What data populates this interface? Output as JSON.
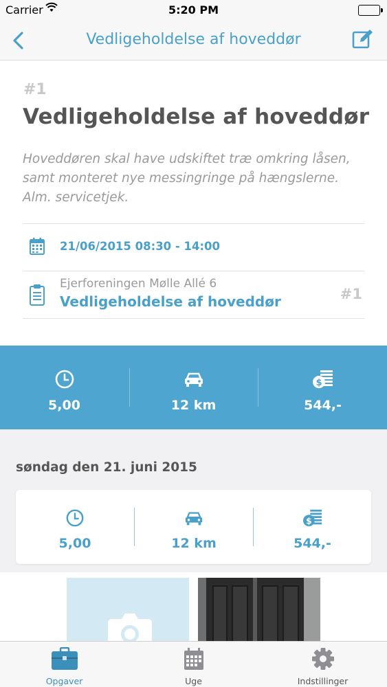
{
  "status_bar": {
    "carrier": "Carrier",
    "time": "5:20 PM"
  },
  "nav": {
    "title": "Vedligeholdelse af hoveddør",
    "back_icon": "chevron-left-icon",
    "edit_icon": "edit-icon"
  },
  "task": {
    "number": "#1",
    "title": "Vedligeholdelse af hoveddør",
    "description": "Hoveddøren skal have udskiftet træ omkring låsen, samt monteret nye messingringe på hængslerne. Alm. servicetjek.",
    "date_range": "21/06/2015 08:30 - 14:00",
    "project_owner": "Ejerforeningen Mølle Allé 6",
    "project_name": "Vedligeholdelse af hoveddør",
    "project_number": "#1"
  },
  "totals": {
    "hours": "5,00",
    "distance": "12 km",
    "amount": "544,-"
  },
  "day": {
    "label": "søndag den 21. juni 2015",
    "hours": "5,00",
    "distance": "12 km",
    "amount": "544,-"
  },
  "tabs": [
    {
      "label": "Opgaver",
      "icon": "briefcase-icon",
      "active": true
    },
    {
      "label": "Uge",
      "icon": "calendar-icon",
      "active": false
    },
    {
      "label": "Indstillinger",
      "icon": "gear-icon",
      "active": false
    }
  ],
  "colors": {
    "accent": "#4aa0c8",
    "band": "#4ea5cf",
    "muted": "#9a9a9a"
  }
}
